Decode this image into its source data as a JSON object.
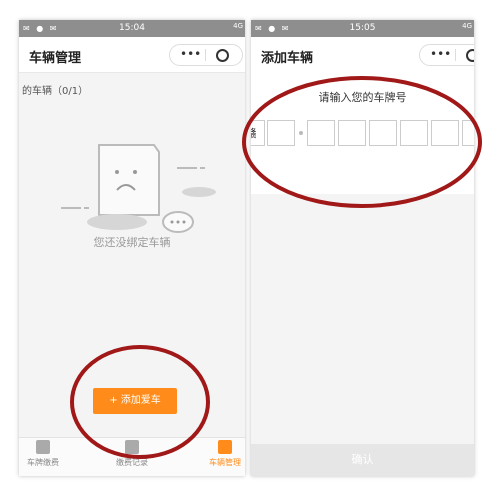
{
  "left_screen": {
    "status_time": "15:04",
    "status_network": "4G",
    "title": "车辆管理",
    "section_label": "的车辆（0/1）",
    "empty_message": "您还没绑定车辆",
    "add_button": "+ 添加爱车",
    "tabs": [
      {
        "label": "车牌缴费",
        "icon": "receipt-icon"
      },
      {
        "label": "缴费记录",
        "icon": "clipboard-icon"
      },
      {
        "label": "车辆管理",
        "icon": "car-icon",
        "active": true
      }
    ]
  },
  "right_screen": {
    "status_time": "15:05",
    "status_network": "4G",
    "title": "添加车辆",
    "plate_prompt": "请输入您的车牌号",
    "plate_fields": [
      "赣",
      "",
      "",
      "",
      "",
      "",
      "",
      ""
    ],
    "confirm_button": "确认"
  },
  "colors": {
    "accent": "#ff8c1a",
    "annotation_circle": "#a01818"
  }
}
